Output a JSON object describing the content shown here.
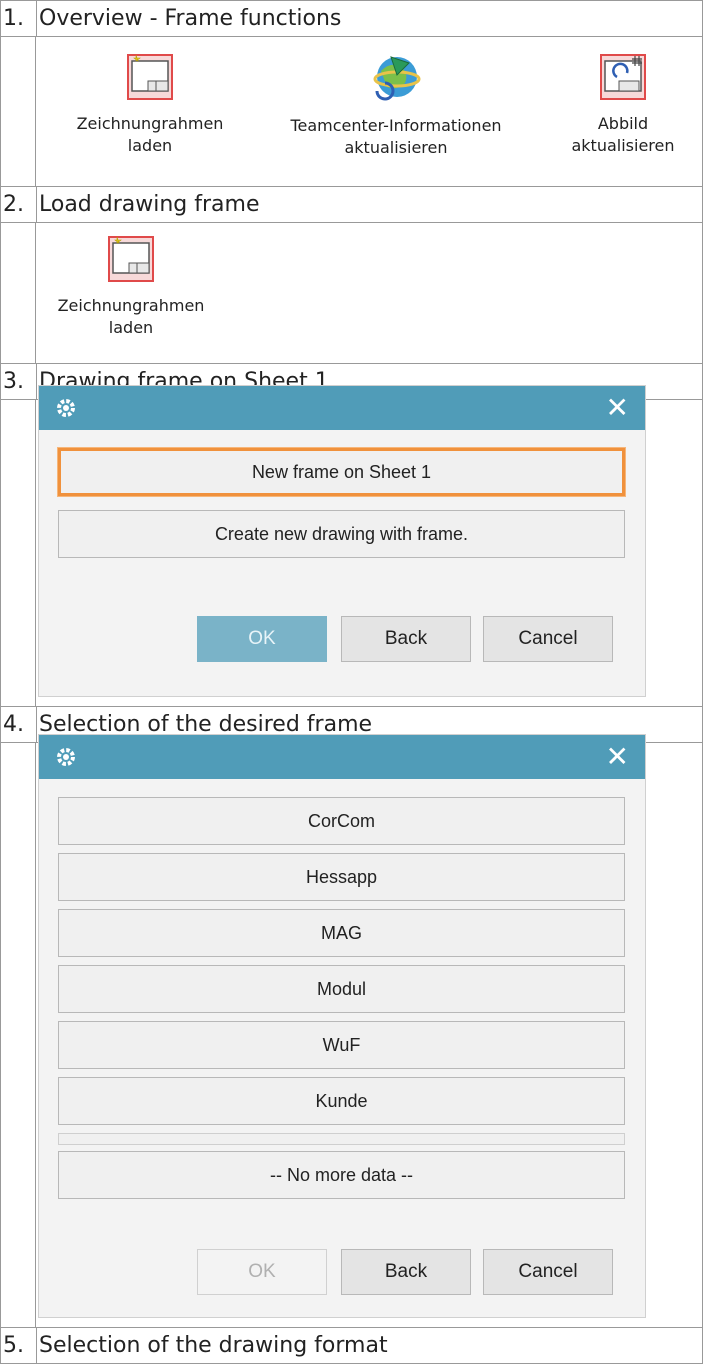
{
  "sections": [
    {
      "num": "1.",
      "title": "Overview - Frame functions"
    },
    {
      "num": "2.",
      "title": "Load drawing frame"
    },
    {
      "num": "3.",
      "title": "Drawing frame on Sheet 1"
    },
    {
      "num": "4.",
      "title": "Selection of the desired frame"
    },
    {
      "num": "5.",
      "title": "Selection of the drawing format"
    }
  ],
  "ribbon": {
    "load_frame_line1": "Zeichnungrahmen",
    "load_frame_line2": "laden",
    "tc_info_line1": "Teamcenter-Informationen",
    "tc_info_line2": "aktualisieren",
    "image_line1": "Abbild",
    "image_line2": "aktualisieren"
  },
  "dialog_sheet": {
    "close_glyph": "✕",
    "options": [
      "New frame on Sheet 1",
      "Create new drawing with frame."
    ],
    "ok": "OK",
    "back": "Back",
    "cancel": "Cancel"
  },
  "dialog_frame": {
    "close_glyph": "✕",
    "options": [
      "CorCom",
      "Hessapp",
      "MAG",
      "Modul",
      "WuF",
      "Kunde",
      "-- No more data --"
    ],
    "ok": "OK",
    "back": "Back",
    "cancel": "Cancel"
  },
  "colors": {
    "title_bar": "#509cb8",
    "selected_border": "#f0913c",
    "ok_active": "#7ab3c8"
  },
  "icons": [
    "load-frame-icon",
    "teamcenter-globe-icon",
    "update-image-icon",
    "gear-icon",
    "close-icon"
  ]
}
